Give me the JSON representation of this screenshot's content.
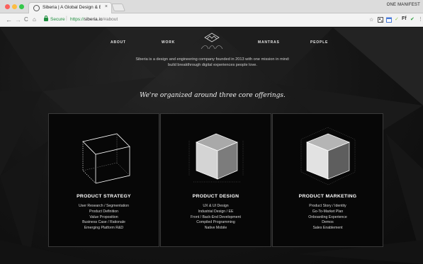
{
  "browser": {
    "tab_title": "Siberia | A Global Design & En",
    "tab_close": "×",
    "profile": "ONE MANIFEST",
    "secure_label": "Secure",
    "url_scheme": "https://",
    "url_host": "siberia.io",
    "url_path": "/#about",
    "nav_back": "←",
    "nav_forward": "→",
    "nav_reload": "C",
    "nav_home": "⌂",
    "toolbar_star": "☆",
    "toolbar_menu": "⋮"
  },
  "nav": {
    "about": "ABOUT",
    "work": "WORK",
    "mantras": "MANTRAS",
    "people": "PEOPLE",
    "logo_icon": "mountain-circle-icon"
  },
  "intro": {
    "line1": "Siberia is a design and engineering company founded in 2013 with one mission in mind:",
    "line2": "build breakthrough digital experiences people love."
  },
  "headline": "We're organized around three core offerings.",
  "offerings": [
    {
      "title": "PRODUCT STRATEGY",
      "items": [
        "User Research / Segmentation",
        "Product Definition",
        "Value Proposition",
        "Business Case / Rationale",
        "Emerging Platform R&D"
      ]
    },
    {
      "title": "PRODUCT DESIGN",
      "items": [
        "UX & UI Design",
        "Industrial Design / EE",
        "Front / Back-End Development",
        "Compiled Programming",
        "Native Mobile"
      ]
    },
    {
      "title": "PRODUCT MARKETING",
      "items": [
        "Product Story / Identity",
        "Go-To-Market Plan",
        "Onboarding Experience",
        "Demos",
        "Sales Enablement"
      ]
    }
  ],
  "colors": {
    "background": "#101010",
    "card_background": "#070707",
    "card_border": "#3a3a3a",
    "secure_green": "#1e8e3e"
  }
}
